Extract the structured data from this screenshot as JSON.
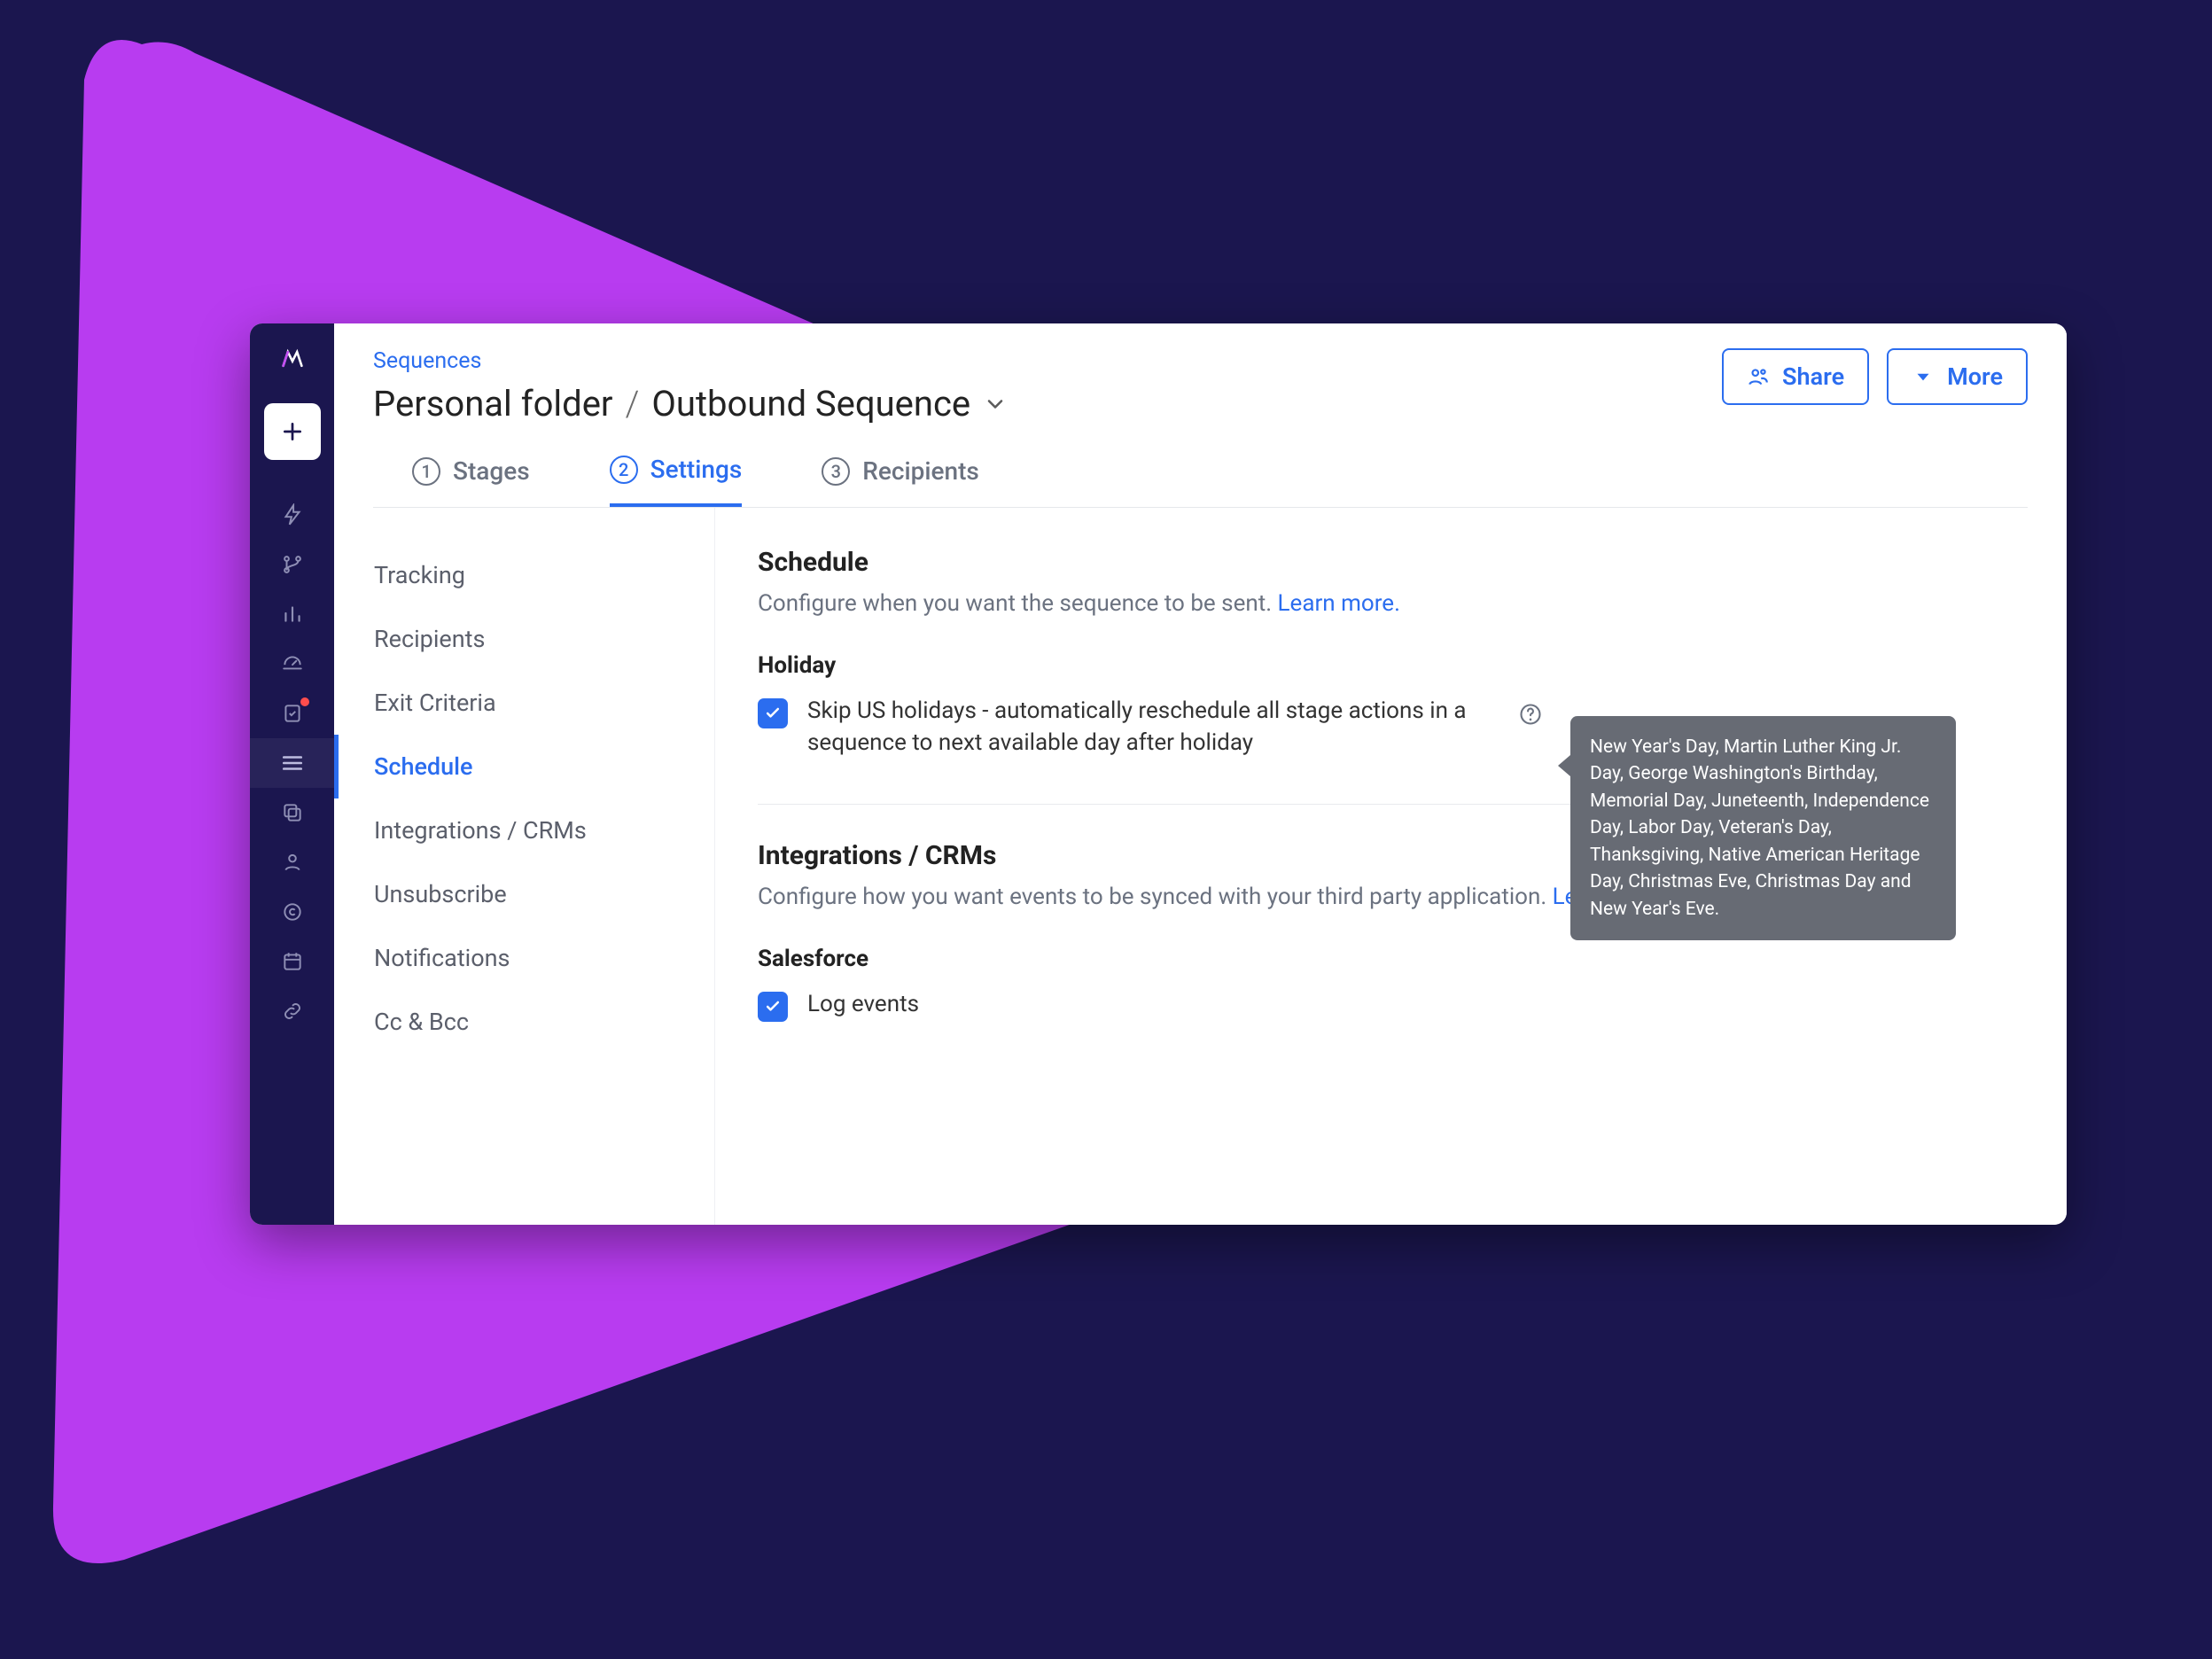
{
  "header": {
    "crumbs_link": "Sequences",
    "folder": "Personal folder",
    "separator": "/",
    "title": "Outbound Sequence",
    "share_label": "Share",
    "more_label": "More"
  },
  "tabs": [
    {
      "num": "1",
      "label": "Stages"
    },
    {
      "num": "2",
      "label": "Settings"
    },
    {
      "num": "3",
      "label": "Recipients"
    }
  ],
  "sidenav": [
    "Tracking",
    "Recipients",
    "Exit Criteria",
    "Schedule",
    "Integrations / CRMs",
    "Unsubscribe",
    "Notifications",
    "Cc & Bcc"
  ],
  "schedule": {
    "title": "Schedule",
    "desc": "Configure when you want the sequence to be sent. ",
    "learn_more": "Learn more.",
    "holiday_heading": "Holiday",
    "holiday_label": "Skip US holidays - automatically reschedule all stage actions in a sequence to next available day after holiday",
    "tooltip": "New Year's Day, Martin Luther King Jr. Day, George Washington's Birthday, Memorial Day, Juneteenth, Independence Day, Labor Day, Veteran's Day, Thanksgiving, Native American Heritage Day, Christmas Eve, Christmas Day and New Year's Eve."
  },
  "integrations": {
    "title": "Integrations / CRMs",
    "desc": "Configure how you want events to be synced with your third party application. ",
    "learn_more": "Learn more.",
    "salesforce_heading": "Salesforce",
    "log_events_label": "Log events"
  }
}
